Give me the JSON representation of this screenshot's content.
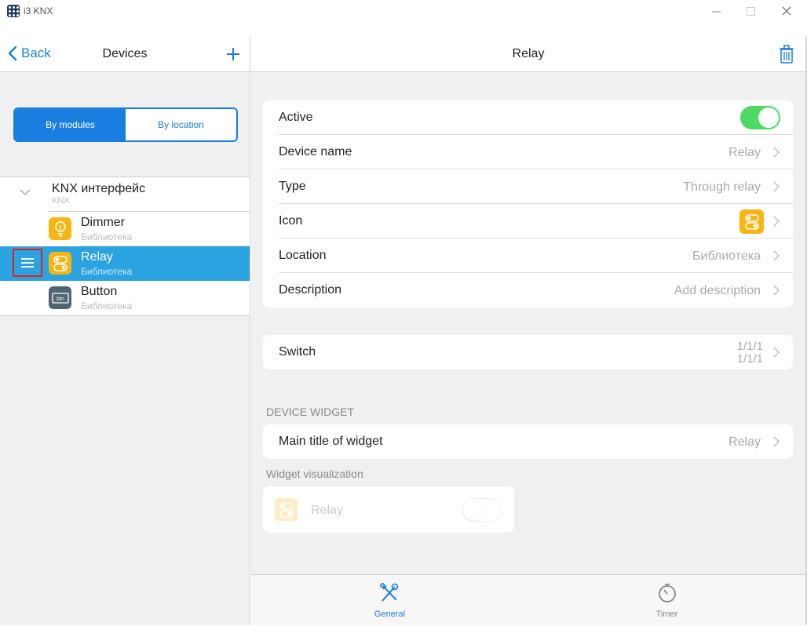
{
  "window": {
    "title": "i3 KNX",
    "minimize": "—",
    "maximize": "☐",
    "close": "✕"
  },
  "left": {
    "back_label": "Back",
    "title": "Devices",
    "add_label": "+",
    "segment": {
      "by_modules": "By modules",
      "by_location": "By location",
      "selected": "By modules"
    },
    "group": {
      "title": "KNX интерфейс",
      "subtitle": "KNX"
    },
    "devices": [
      {
        "name": "Dimmer",
        "location": "Библиотека",
        "icon": "lightbulb-icon",
        "color": "#f8b511"
      },
      {
        "name": "Relay",
        "location": "Библиотека",
        "icon": "relay-switch-icon",
        "color": "#f8b511",
        "selected": true
      },
      {
        "name": "Button",
        "location": "Библиотека",
        "icon": "button-btn-icon",
        "color": "#4f6672"
      }
    ]
  },
  "right": {
    "title": "Relay",
    "props": {
      "active": {
        "label": "Active",
        "on": true
      },
      "device_name": {
        "label": "Device name",
        "value": "Relay"
      },
      "type": {
        "label": "Type",
        "value": "Through relay"
      },
      "icon": {
        "label": "Icon",
        "value_icon": "relay-switch-icon"
      },
      "location": {
        "label": "Location",
        "value": "Библиотека"
      },
      "description": {
        "label": "Description",
        "value": "Add description"
      }
    },
    "switch": {
      "label": "Switch",
      "addr1": "1/1/1",
      "addr2": "1/1/1"
    },
    "device_widget": {
      "section": "DEVICE WIDGET",
      "main_title": {
        "label": "Main title of widget",
        "value": "Relay"
      },
      "visualization_label": "Widget visualization",
      "preview_label": "Relay"
    },
    "tabs": {
      "general": "General",
      "timer": "Timer",
      "active": "General"
    }
  },
  "colors": {
    "accent": "#1a7de0",
    "selection": "#2aa3e0",
    "toggle_on": "#4cd964",
    "device_yellow": "#f8b511"
  }
}
